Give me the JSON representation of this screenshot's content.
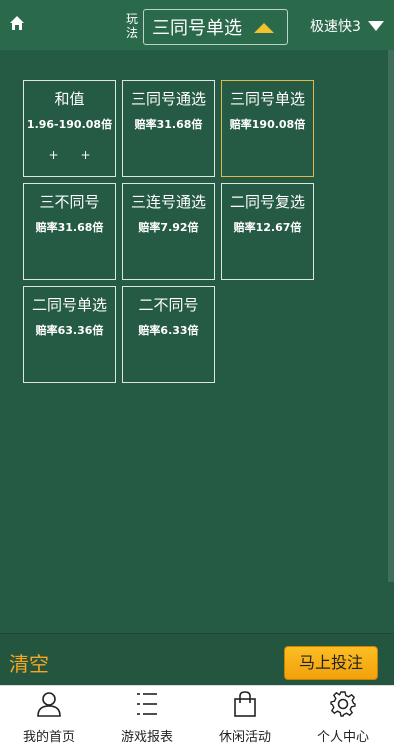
{
  "header": {
    "play_label": "玩法",
    "selected_play": "三同号单选",
    "game_name": "极速快3"
  },
  "bets": [
    {
      "name": "和值",
      "odds": "1.96-190.08倍",
      "extra": [
        "+",
        "+"
      ]
    },
    {
      "name": "三同号通选",
      "odds": "赔率31.68倍"
    },
    {
      "name": "三同号单选",
      "odds": "赔率190.08倍",
      "selected": true
    },
    {
      "name": "三不同号",
      "odds": "赔率31.68倍"
    },
    {
      "name": "三连号通选",
      "odds": "赔率7.92倍"
    },
    {
      "name": "二同号复选",
      "odds": "赔率12.67倍"
    },
    {
      "name": "二同号单选",
      "odds": "赔率63.36倍"
    },
    {
      "name": "二不同号",
      "odds": "赔率6.33倍"
    }
  ],
  "actions": {
    "clear_label": "清空",
    "bet_now_label": "马上投注"
  },
  "tabs": [
    {
      "label": "我的首页",
      "icon": "person-icon"
    },
    {
      "label": "游戏报表",
      "icon": "list-icon"
    },
    {
      "label": "休闲活动",
      "icon": "bag-icon"
    },
    {
      "label": "个人中心",
      "icon": "gear-icon"
    }
  ],
  "colors": {
    "background": "#255A44",
    "header": "#2A6A4B",
    "accent": "#F5A623",
    "selected_border": "#E1B94A"
  }
}
